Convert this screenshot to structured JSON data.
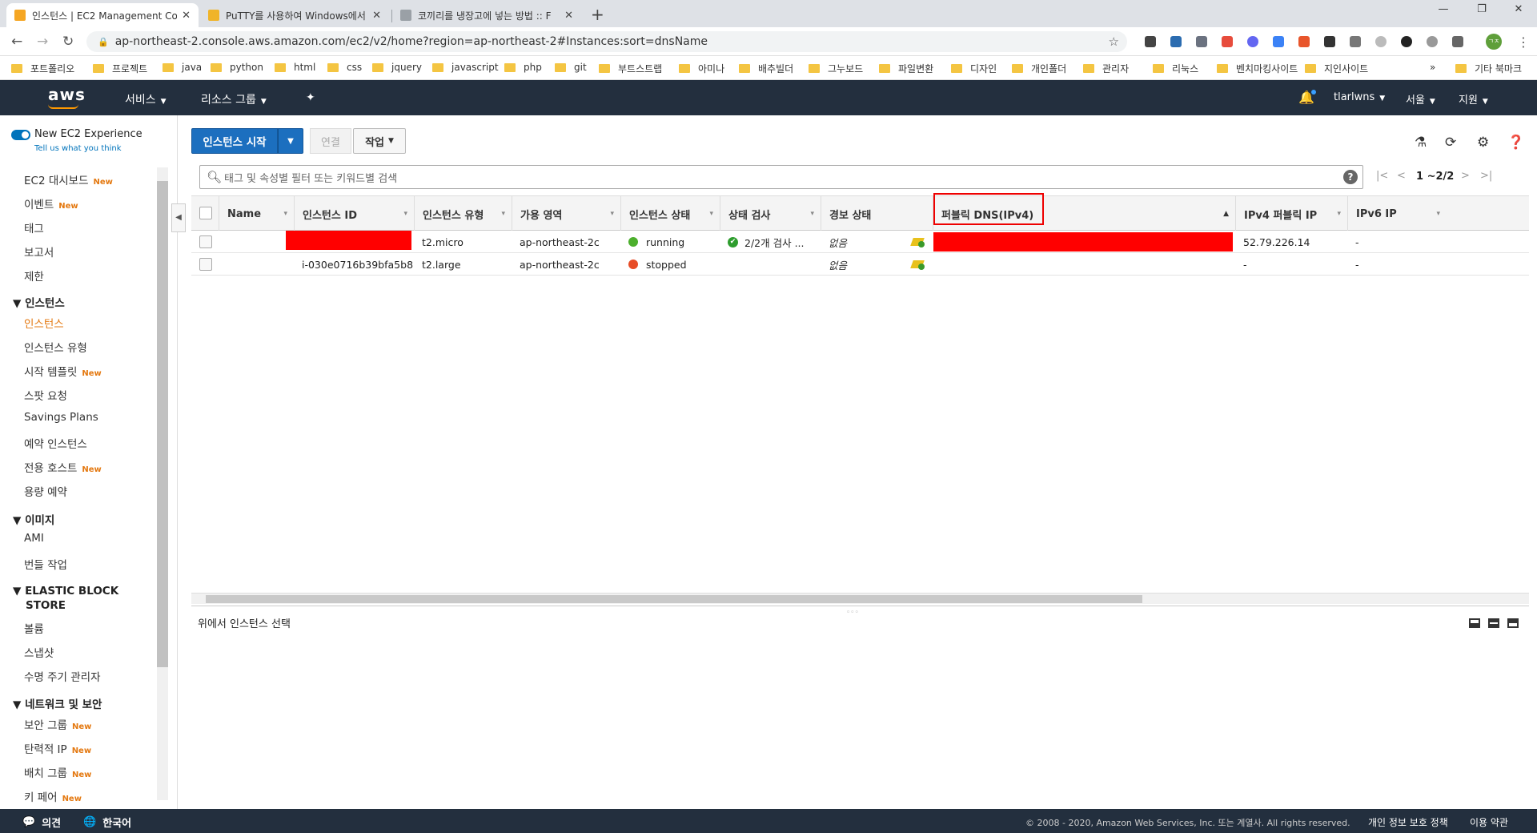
{
  "browser": {
    "tabs": [
      {
        "title": "인스턴스 | EC2 Management Co",
        "favicon_color": "#f5a623",
        "active": true
      },
      {
        "title": "PuTTY를 사용하여 Windows에서",
        "favicon_color": "#f0b429",
        "active": false
      },
      {
        "title": "코끼리를 냉장고에 넣는 방법 :: F",
        "favicon_color": "#9aa0a6",
        "active": false
      }
    ],
    "tab_close_glyph": "✕",
    "new_tab_glyph": "+",
    "window_controls": [
      "—",
      "❐",
      "✕"
    ],
    "url": "ap-northeast-2.console.aws.amazon.com/ec2/v2/home?region=ap-northeast-2#Instances:sort=dnsName"
  },
  "bookmarks": [
    "포트폴리오",
    "프로젝트",
    "java",
    "python",
    "html",
    "css",
    "jquery",
    "javascript",
    "php",
    "git",
    "부트스트랩",
    "아미나",
    "배추빌더",
    "그누보드",
    "파일변환",
    "디자인",
    "개인폴더",
    "관리자",
    "리눅스",
    "벤치마킹사이트",
    "지인사이트"
  ],
  "bookmarks_more": "»",
  "bookmarks_other": "기타 북마크",
  "profile_initial": "ㄱㅈ",
  "aws": {
    "logo": "aws",
    "services": "서비스",
    "resource_groups": "리소스 그룹",
    "user": "tlarlwns",
    "region": "서울",
    "support": "지원"
  },
  "sidebar": {
    "experience_label": "New EC2 Experience",
    "experience_sub": "Tell us what you think",
    "new_badge": "New",
    "top_items": [
      {
        "label": "EC2 대시보드",
        "new": true
      },
      {
        "label": "이벤트",
        "new": true
      },
      {
        "label": "태그",
        "new": false
      },
      {
        "label": "보고서",
        "new": false
      },
      {
        "label": "제한",
        "new": false
      }
    ],
    "instances_head": "▼ 인스턴스",
    "instances_items": [
      {
        "label": "인스턴스",
        "active": true,
        "new": false
      },
      {
        "label": "인스턴스 유형",
        "new": false
      },
      {
        "label": "시작 템플릿",
        "new": true
      },
      {
        "label": "스팟 요청",
        "new": false
      },
      {
        "label": "Savings Plans",
        "new": false
      },
      {
        "label": "예약 인스턴스",
        "new": false
      },
      {
        "label": "전용 호스트",
        "new": true
      },
      {
        "label": "용량 예약",
        "new": false
      }
    ],
    "images_head": "▼ 이미지",
    "images_items": [
      {
        "label": "AMI"
      },
      {
        "label": "번들 작업"
      }
    ],
    "ebs_head_1": "▼ ELASTIC BLOCK",
    "ebs_head_2": "STORE",
    "ebs_items": [
      {
        "label": "볼륨"
      },
      {
        "label": "스냅샷"
      },
      {
        "label": "수명 주기 관리자"
      }
    ],
    "network_head": "▼ 네트워크 및 보안",
    "network_items": [
      {
        "label": "보안 그룹",
        "new": true
      },
      {
        "label": "탄력적 IP",
        "new": true
      },
      {
        "label": "배치 그룹",
        "new": true
      },
      {
        "label": "키 페어",
        "new": true
      }
    ]
  },
  "toolbar": {
    "launch": "인스턴스 시작",
    "connect": "연결",
    "actions": "작업"
  },
  "search": {
    "placeholder": "태그 및 속성별 필터 또는 키워드별 검색"
  },
  "pager": {
    "count": "1 ~2/2"
  },
  "table": {
    "columns": [
      "Name",
      "인스턴스 ID",
      "인스턴스 유형",
      "가용 영역",
      "인스턴스 상태",
      "상태 검사",
      "경보 상태",
      "퍼블릭 DNS(IPv4)",
      "IPv4 퍼블릭 IP",
      "IPv6 IP"
    ],
    "rows": [
      {
        "name": "",
        "id": "",
        "type": "t2.micro",
        "az": "ap-northeast-2c",
        "state": "running",
        "state_color": "green",
        "check": "2/2개 검사 ...",
        "alarm": "없음",
        "dns": "",
        "ipv4": "52.79.226.14",
        "ipv6": "-"
      },
      {
        "name": "",
        "id": "i-030e0716b39bfa5b8",
        "type": "t2.large",
        "az": "ap-northeast-2c",
        "state": "stopped",
        "state_color": "red",
        "check": "",
        "alarm": "없음",
        "dns": "",
        "ipv4": "-",
        "ipv6": "-"
      }
    ]
  },
  "detail": {
    "label": "위에서 인스턴스 선택"
  },
  "footer": {
    "feedback": "의견",
    "language": "한국어",
    "copyright": "© 2008 - 2020, Amazon Web Services, Inc. 또는 계열사. All rights reserved.",
    "privacy": "개인 정보 보호 정책",
    "terms": "이용 약관"
  }
}
